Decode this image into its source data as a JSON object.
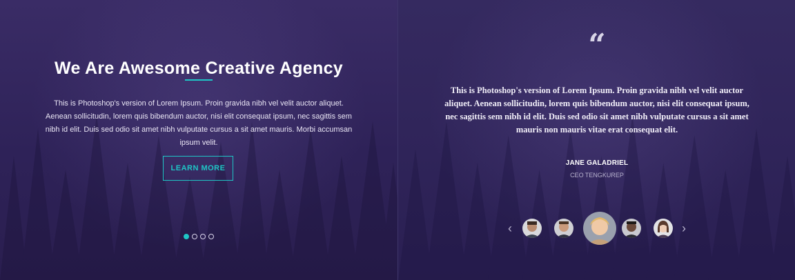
{
  "hero": {
    "title": "We Are Awesome Creative Agency",
    "body": "This is Photoshop's version of Lorem Ipsum. Proin gravida nibh vel velit auctor aliquet. Aenean sollicitudin, lorem quis bibendum auctor, nisi elit consequat ipsum, nec sagittis sem nibh id elit. Duis sed odio sit amet nibh vulputate cursus a sit amet mauris. Morbi accumsan ipsum velit.",
    "button_label": "LEARN MORE",
    "slide_count": 4,
    "active_slide": 1
  },
  "testimonial": {
    "quote_icon": "quote-icon",
    "quote": "This is Photoshop's version of Lorem Ipsum. Proin gravida nibh vel velit auctor aliquet. Aenean sollicitudin, lorem quis bibendum auctor, nisi elit consequat ipsum, nec sagittis sem nibh id elit. Duis sed odio sit amet nibh vulputate cursus a sit amet mauris non mauris vitae erat consequat elit.",
    "author": "JANE GALADRIEL",
    "role": "CEO TENGKUREP",
    "prev_icon": "chevron-left-icon",
    "next_icon": "chevron-right-icon",
    "avatar_count": 5,
    "active_avatar": 3
  },
  "colors": {
    "accent": "#1fc6c6",
    "background": "#2e2258"
  }
}
